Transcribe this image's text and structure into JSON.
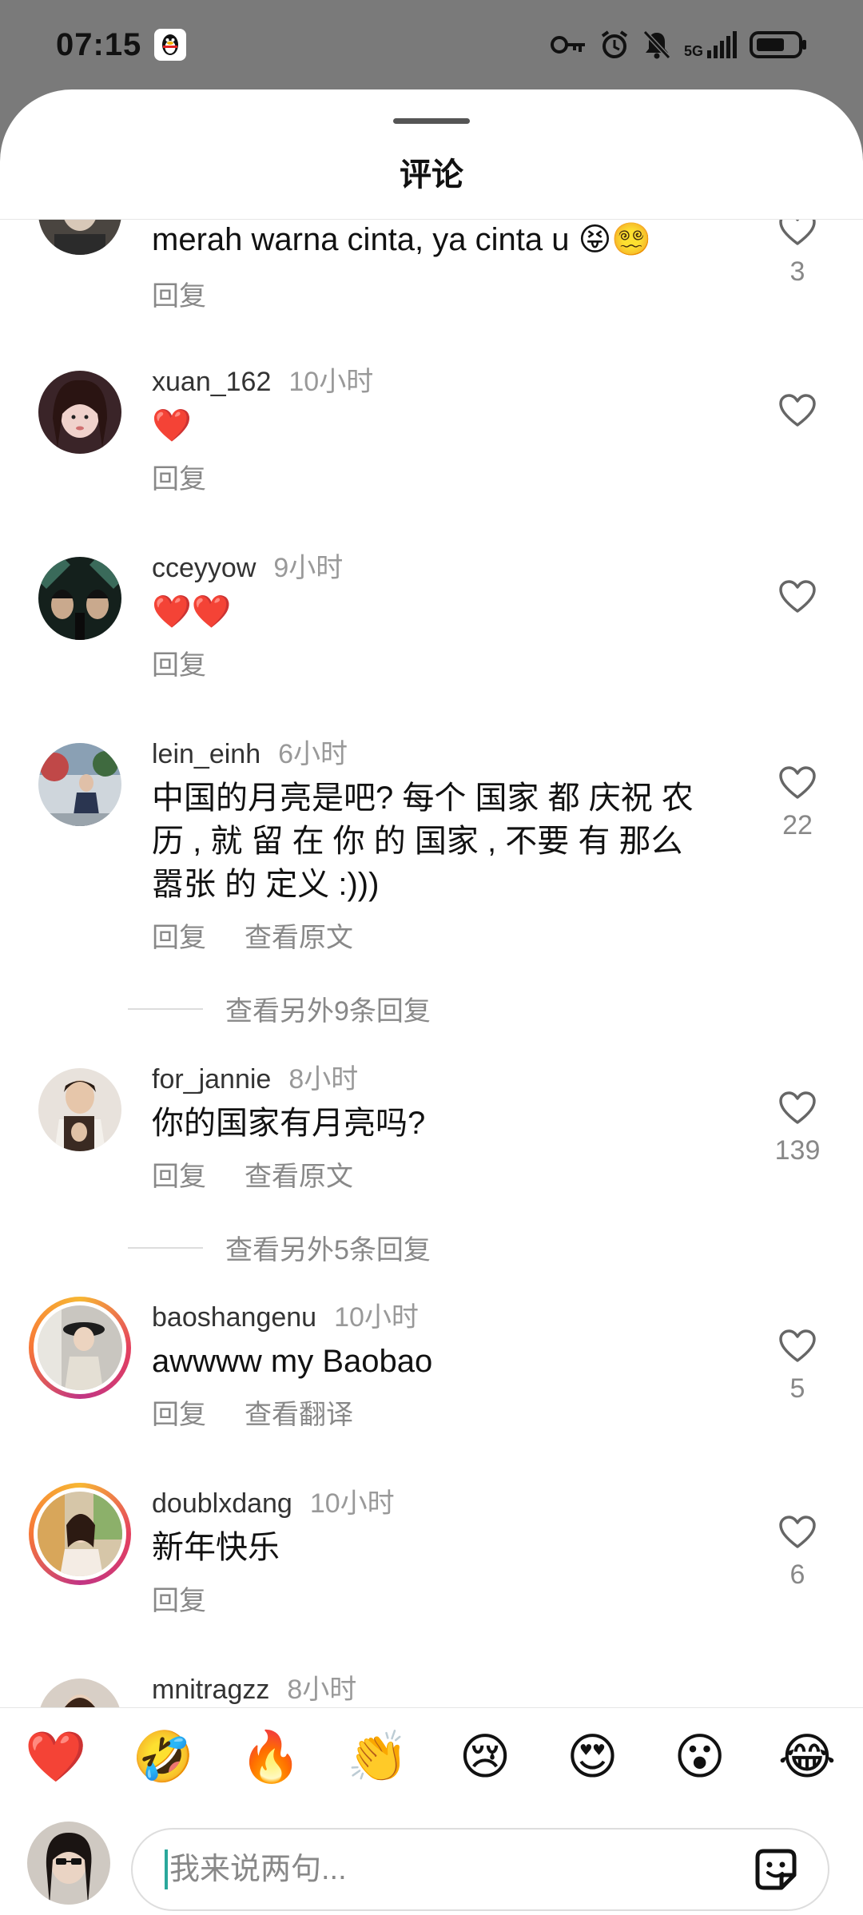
{
  "status_bar": {
    "time": "07:15",
    "network": "5G"
  },
  "sheet": {
    "title": "评论"
  },
  "comments": [
    {
      "username": "",
      "time": "",
      "text": "merah warna cinta, ya cinta u 😝😵‍💫",
      "actions": [
        "回复"
      ],
      "likes": "3"
    },
    {
      "username": "xuan_162",
      "time": "10小时",
      "text": "❤️",
      "actions": [
        "回复"
      ],
      "likes": ""
    },
    {
      "username": "cceyyow",
      "time": "9小时",
      "text": "❤️❤️",
      "actions": [
        "回复"
      ],
      "likes": ""
    },
    {
      "username": "lein_einh",
      "time": "6小时",
      "text": "中国的月亮是吧? 每个 国家 都 庆祝 农历 , 就 留 在 你 的 国家 , 不要 有 那么 嚣张 的 定义 :)))",
      "actions": [
        "回复",
        "查看原文"
      ],
      "likes": "22",
      "more_replies": "查看另外9条回复"
    },
    {
      "username": "for_jannie",
      "time": "8小时",
      "text": "你的国家有月亮吗?",
      "actions": [
        "回复",
        "查看原文"
      ],
      "likes": "139",
      "more_replies": "查看另外5条回复"
    },
    {
      "username": "baoshangenu",
      "time": "10小时",
      "text": "awwww my Baobao",
      "actions": [
        "回复",
        "查看翻译"
      ],
      "likes": "5"
    },
    {
      "username": "doublxdang",
      "time": "10小时",
      "text": "新年快乐",
      "actions": [
        "回复"
      ],
      "likes": "6"
    },
    {
      "username": "mnitragzz",
      "time": "8小时",
      "text": "",
      "actions": [],
      "likes": ""
    }
  ],
  "emoji_bar": [
    "❤️",
    "🤣",
    "🔥",
    "👏",
    "😢",
    "😍",
    "😮",
    "😂"
  ],
  "input": {
    "placeholder": "我来说两句..."
  },
  "colors": {
    "accent": "#2aa79b",
    "heart_red": "#e0245e",
    "ring": "#e4405f"
  }
}
